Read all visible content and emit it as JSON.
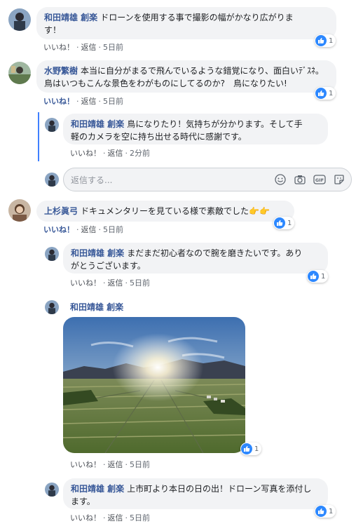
{
  "comments": [
    {
      "author": "和田靖雄 創楽",
      "text_lines": [
        "ドローンを使用する事で撮影の幅がかなり広がりま",
        "す！"
      ],
      "like_label": "いいね！",
      "reply_label": "返信",
      "time": "5日前",
      "reactions": "1"
    },
    {
      "author": "水野繁樹",
      "text_lines": [
        "本当に自分がまるで飛んでいるような錯覚になり、面白いﾃﾞｽﾈ。鳥はいつもこんな景色をわがものにしてるのか?　鳥になりたい!"
      ],
      "like_label": "いいね！",
      "reply_label": "返信",
      "time": "5日前",
      "reactions": "1",
      "liked": true
    },
    {
      "author": "和田靖雄 創楽",
      "text_lines": [
        "鳥になりたり！気持ちが分かります。そして手",
        "軽のカメラを空に持ち出せる時代に感謝です。"
      ],
      "like_label": "いいね！",
      "reply_label": "返信",
      "time": "2分前"
    },
    {
      "author": "上杉眞弓",
      "text_lines": [
        "ドキュメンタリーを見ている様で素敵でした👉👉"
      ],
      "like_label": "いいね！",
      "reply_label": "返信",
      "time": "5日前",
      "reactions": "1",
      "liked": true
    },
    {
      "author": "和田靖雄 創楽",
      "text_lines": [
        "まだまだ初心者なので腕を磨きたいです。あり",
        "がとうございます。"
      ],
      "like_label": "いいね！",
      "reply_label": "返信",
      "time": "5日前",
      "reactions": "1"
    },
    {
      "author": "和田靖雄 創楽",
      "text_lines": [],
      "like_label": "いいね！",
      "reply_label": "返信",
      "time": "5日前",
      "reactions": "1"
    },
    {
      "author": "和田靖雄 創楽",
      "text_lines": [
        "上市町より本日の日の出！ドローン写真を添付し",
        "ます。"
      ],
      "like_label": "いいね！",
      "reply_label": "返信",
      "time": "5日前",
      "reactions": "1"
    }
  ],
  "reply_input": {
    "placeholder": "返信する..."
  },
  "dot": "·",
  "colors": {
    "name": "#385898",
    "bubble": "#f2f3f5",
    "thread": "#4080ff",
    "like": "#2d88ff"
  },
  "icons": [
    "smile-icon",
    "camera-icon",
    "gif-icon",
    "sticker-icon",
    "like-thumb-icon"
  ]
}
